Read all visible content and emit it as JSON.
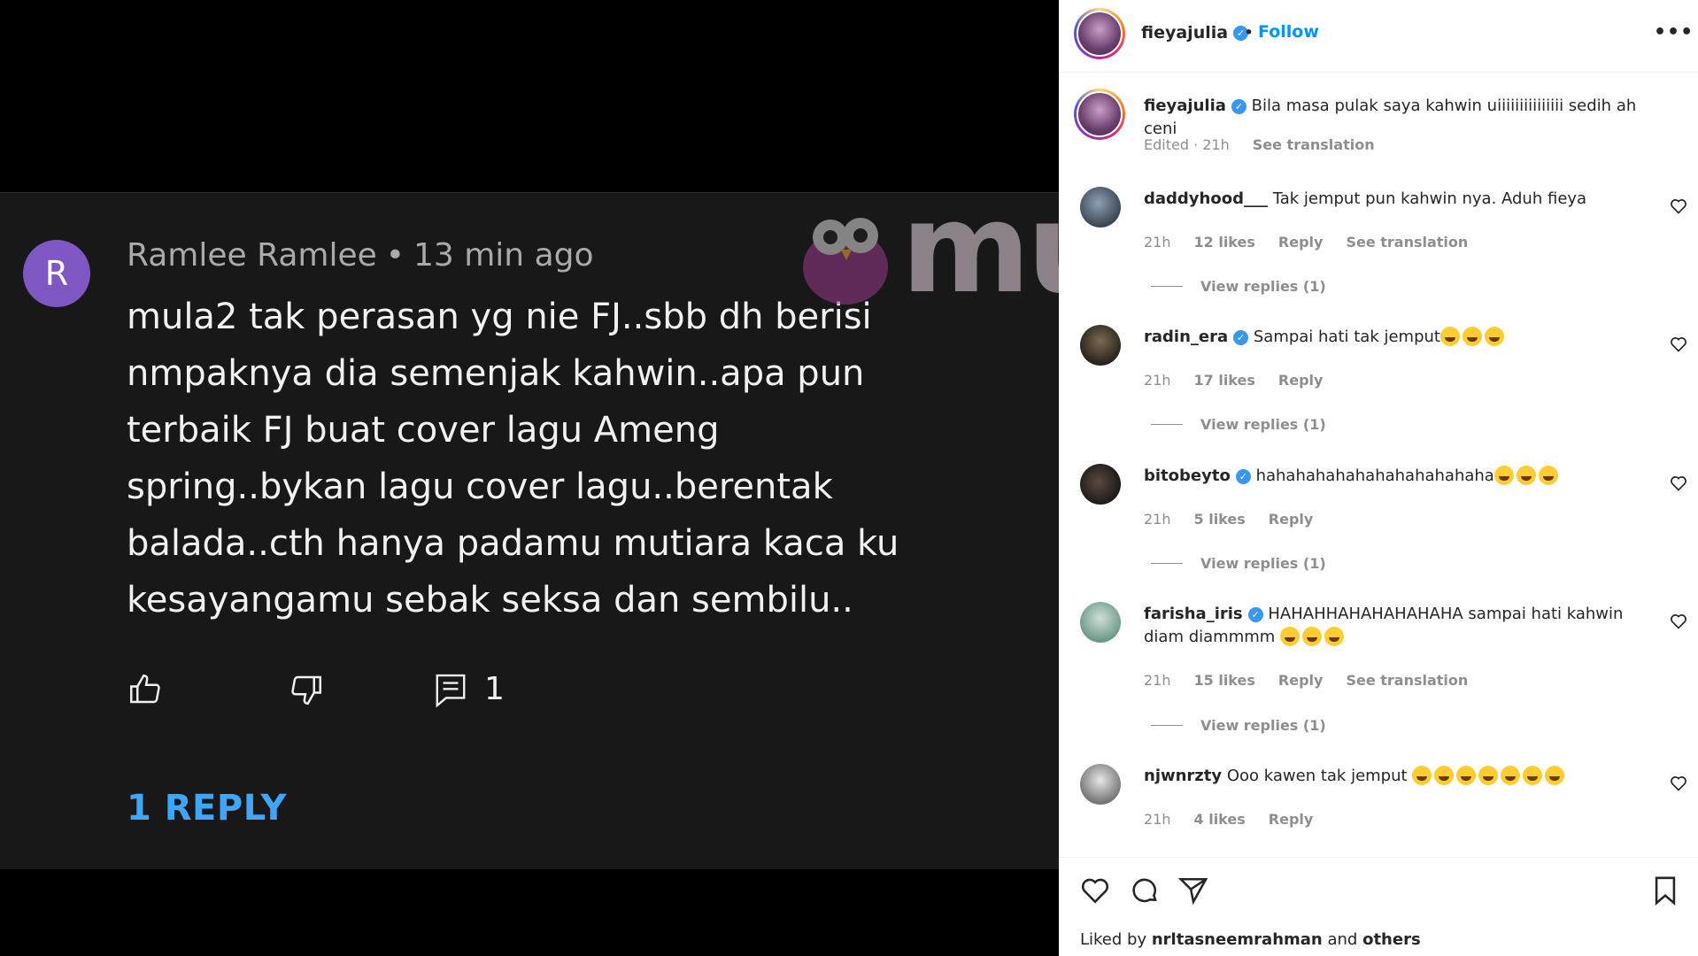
{
  "youtube": {
    "avatar_letter": "R",
    "author": "Ramlee Ramlee",
    "separator": "•",
    "time": "13 min ago",
    "text": "mula2 tak perasan yg nie FJ..sbb dh berisi nmpaknya dia semenjak kahwin..apa pun terbaik FJ buat cover lagu Ameng spring..bykan lagu cover lagu..berentak balada..cth hanya padamu mutiara kaca ku kesayangamu sebak seksa dan sembilu..",
    "reply_count": "1",
    "replies_label": "1 REPLY",
    "avatar_color": "#7e57c2",
    "link_color": "#3ea6ff"
  },
  "watermark": {
    "text": "murai"
  },
  "instagram": {
    "header": {
      "username": "fieyajulia",
      "dot": "•",
      "follow_label": "Follow",
      "more_label": "•••"
    },
    "caption": {
      "username": "fieyajulia",
      "text": "Bila masa pulak saya kahwin uiiiiiiiiiiiiiii sedih ah ceni",
      "edited": "Edited · 21h",
      "see_translation": "See translation"
    },
    "comments": [
      {
        "username": "daddyhood___",
        "verified": false,
        "text": "Tak jemput pun kahwin nya. Aduh fieya",
        "time": "21h",
        "likes": "12 likes",
        "reply": "Reply",
        "see_translation": "See translation",
        "view_replies": "View replies (1)"
      },
      {
        "username": "radin_era",
        "verified": true,
        "text": "Sampai hati tak jemput",
        "time": "21h",
        "likes": "17 likes",
        "reply": "Reply",
        "view_replies": "View replies (1)"
      },
      {
        "username": "bitobeyto",
        "verified": true,
        "text": "hahahahahahahahahahahaha",
        "time": "21h",
        "likes": "5 likes",
        "reply": "Reply",
        "view_replies": "View replies (1)"
      },
      {
        "username": "farisha_iris",
        "verified": true,
        "text": "HAHAHHAHAHAHAHAHA sampai hati kahwin diam diammmm",
        "time": "21h",
        "likes": "15 likes",
        "reply": "Reply",
        "see_translation": "See translation",
        "view_replies": "View replies (1)"
      },
      {
        "username": "njwnrzty",
        "verified": false,
        "text": "Ooo kawen tak jemput",
        "time": "21h",
        "likes": "4 likes",
        "reply": "Reply"
      }
    ],
    "liked_by_prefix": "Liked by",
    "liked_by_user": "nrltasneemrahman",
    "liked_by_and": "and",
    "liked_by_others": "others",
    "follow_color": "#0095f6"
  }
}
